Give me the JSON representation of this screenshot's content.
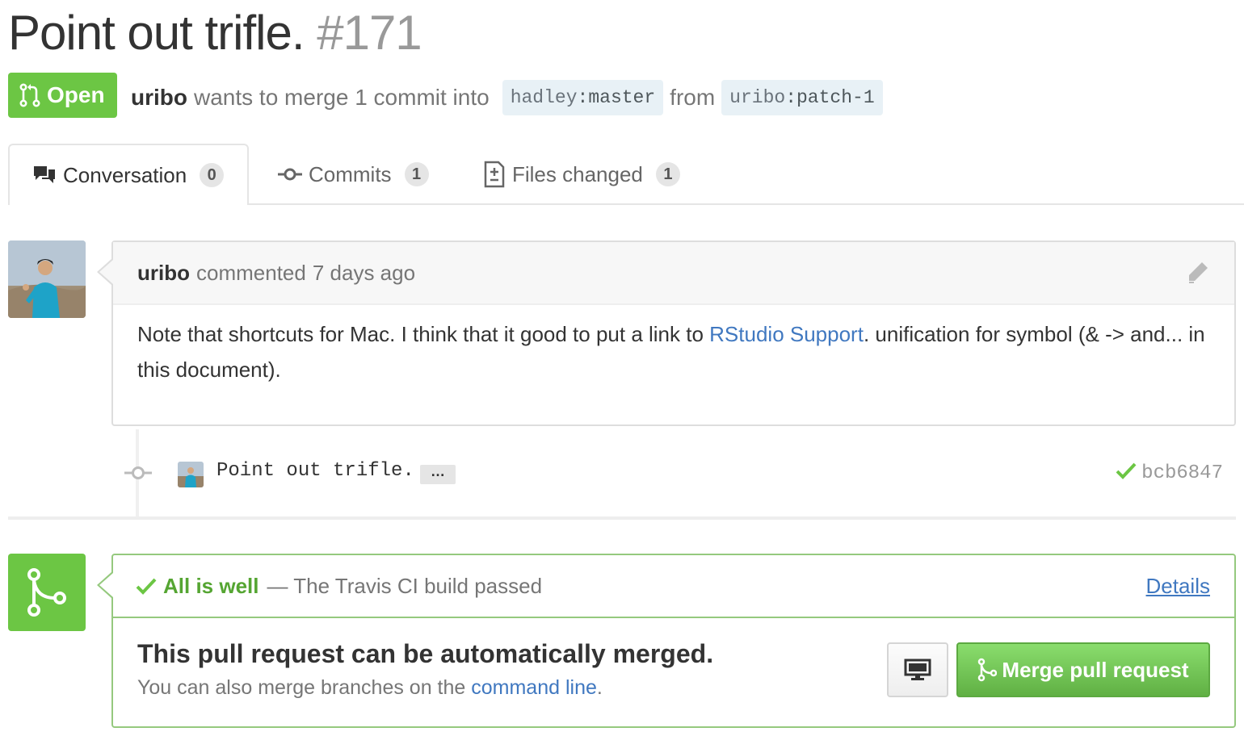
{
  "pr": {
    "title": "Point out trifle.",
    "number": "#171",
    "state": "Open",
    "author": "uribo",
    "meta_text": "wants to merge 1 commit into",
    "from_text": "from",
    "base_repo": "hadley",
    "base_branch": "master",
    "head_repo": "uribo",
    "head_branch": "patch-1"
  },
  "tabs": [
    {
      "label": "Conversation",
      "count": "0",
      "icon": "comment-discussion-icon"
    },
    {
      "label": "Commits",
      "count": "1",
      "icon": "git-commit-icon"
    },
    {
      "label": "Files changed",
      "count": "1",
      "icon": "file-diff-icon"
    }
  ],
  "comment": {
    "author": "uribo",
    "action": "commented",
    "time": "7 days ago",
    "body_1": "Note that shortcuts for Mac. I think that it good to put a link to ",
    "link_text": "RStudio Support",
    "body_2": ". unification for symbol (& -> and... in this document)."
  },
  "commit": {
    "message": "Point out trifle.",
    "ellipsis": "…",
    "sha": "bcb6847"
  },
  "merge": {
    "status_title": "All is well",
    "status_text": "— The Travis CI build passed",
    "details_label": "Details",
    "message": "This pull request can be automatically merged.",
    "sub_text": "You can also merge branches on the ",
    "sub_link": "command line",
    "sub_end": ".",
    "button_label": "Merge pull request"
  },
  "colors": {
    "green": "#6cc644",
    "link": "#4078c0",
    "muted": "#767676"
  }
}
